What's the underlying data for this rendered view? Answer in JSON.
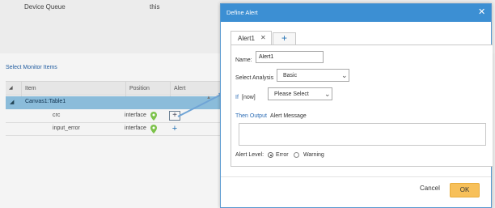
{
  "background": {
    "device_queue_label": "Device Queue",
    "device_queue_value": "this",
    "select_monitor_items_title": "Select Monitor Items",
    "grid": {
      "columns": [
        "Item",
        "Position",
        "Alert"
      ],
      "table_row_label": "Canvas1:Table1",
      "rows": [
        {
          "item": "crc",
          "position": "interface"
        },
        {
          "item": "input_error",
          "position": "interface"
        }
      ]
    }
  },
  "dialog": {
    "title": "Define Alert",
    "tab_label": "Alert1",
    "name_label": "Name:",
    "name_value": "Alert1",
    "select_analysis_label": "Select Analysis",
    "analysis_value": "Basic",
    "if_label": "If",
    "now_label": "[now]",
    "if_select_value": "Please Select",
    "then_output_label": "Then Output",
    "alert_message_label": "Alert Message",
    "alert_level_label": "Alert Level:",
    "level_options": [
      "Error",
      "Warning"
    ],
    "level_selected": "Error",
    "cancel_label": "Cancel",
    "ok_label": "OK"
  },
  "icons": {
    "close": "close-icon",
    "tab_close": "close-icon",
    "add": "plus-icon",
    "pin": "map-pin-icon",
    "dropdown": "chevron-down-icon"
  },
  "colors": {
    "titlebar": "#3c8fd3",
    "link_blue": "#2d6db5",
    "ok_button": "#f7c05a",
    "selected_row": "#8bbcda"
  }
}
